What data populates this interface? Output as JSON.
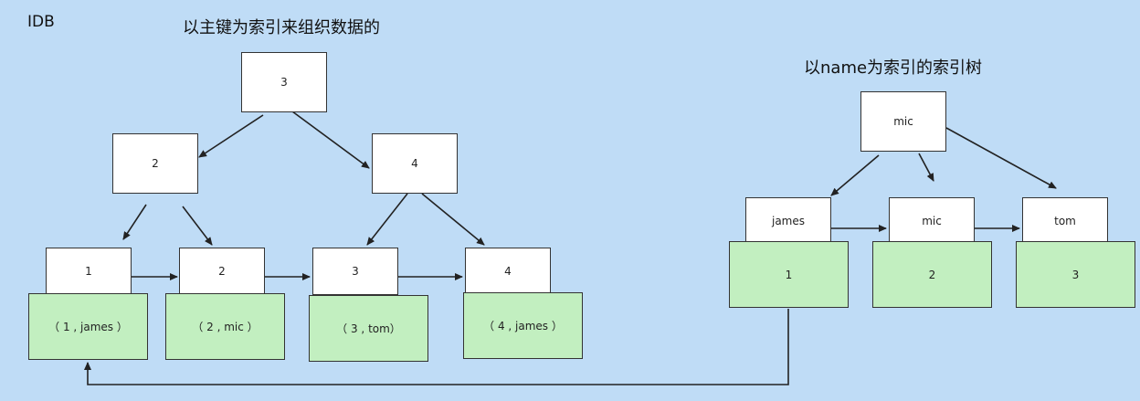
{
  "labels": {
    "idb": "IDB",
    "primary_title": "以主键为索引来组织数据的",
    "secondary_title": "以name为索引的索引树"
  },
  "primary_tree": {
    "root": "3",
    "level2": [
      "2",
      "4"
    ],
    "leaf_keys": [
      "1",
      "2",
      "3",
      "4"
    ],
    "leaf_rows": [
      "（ 1 , james ）",
      "（ 2 , mic ）",
      "（ 3 , tom）",
      "（ 4 , james ）"
    ]
  },
  "secondary_tree": {
    "root": "mic",
    "leaf_keys": [
      "james",
      "mic",
      "tom"
    ],
    "leaf_values": [
      "1",
      "2",
      "3"
    ]
  }
}
